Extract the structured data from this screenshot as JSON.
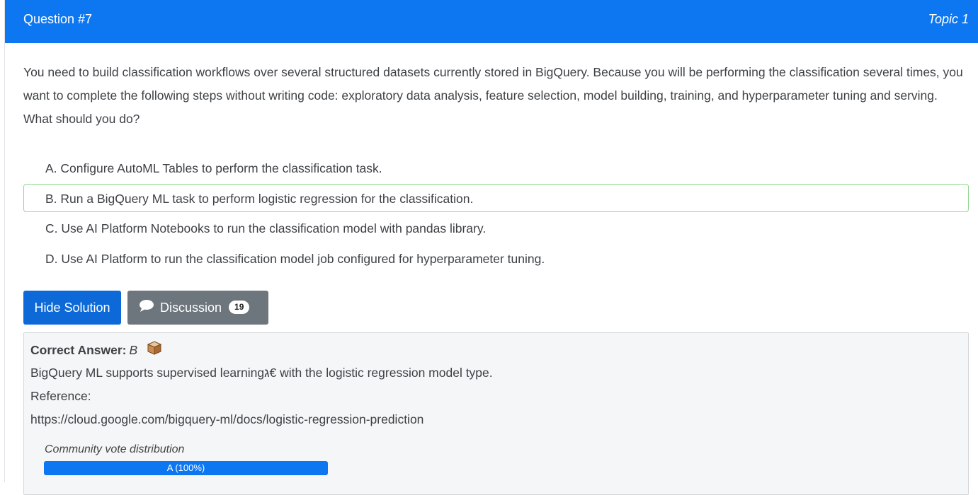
{
  "header": {
    "question_number": "Question #7",
    "topic": "Topic 1"
  },
  "question": {
    "text": "You need to build classification workflows over several structured datasets currently stored in BigQuery. Because you will be performing the classification several times, you want to complete the following steps without writing code: exploratory data analysis, feature selection, model building, training, and hyperparameter tuning and serving. What should you do?"
  },
  "choices": [
    {
      "label": "A. Configure AutoML Tables to perform the classification task."
    },
    {
      "label": "B. Run a BigQuery ML task to perform logistic regression for the classification."
    },
    {
      "label": "C. Use AI Platform Notebooks to run the classification model with pandas library."
    },
    {
      "label": "D. Use AI Platform to run the classification model job configured for hyperparameter tuning."
    }
  ],
  "buttons": {
    "hide_solution": "Hide Solution",
    "discussion": "Discussion",
    "discussion_count": "19"
  },
  "answer": {
    "label": "Correct Answer:",
    "value": "B",
    "explanation": "BigQuery ML supports supervised learningג€ with the logistic regression model type.",
    "reference_label": "Reference:",
    "reference_url": "https://cloud.google.com/bigquery-ml/docs/logistic-regression-prediction"
  },
  "vote": {
    "title": "Community vote distribution",
    "bar_label": "A (100%)",
    "bar_fraction": 1.0
  },
  "colors": {
    "header": "#0d77f2",
    "hide_button": "#0d69d8",
    "discussion_button": "#6d757d",
    "correct_border": "#8fd98f"
  }
}
